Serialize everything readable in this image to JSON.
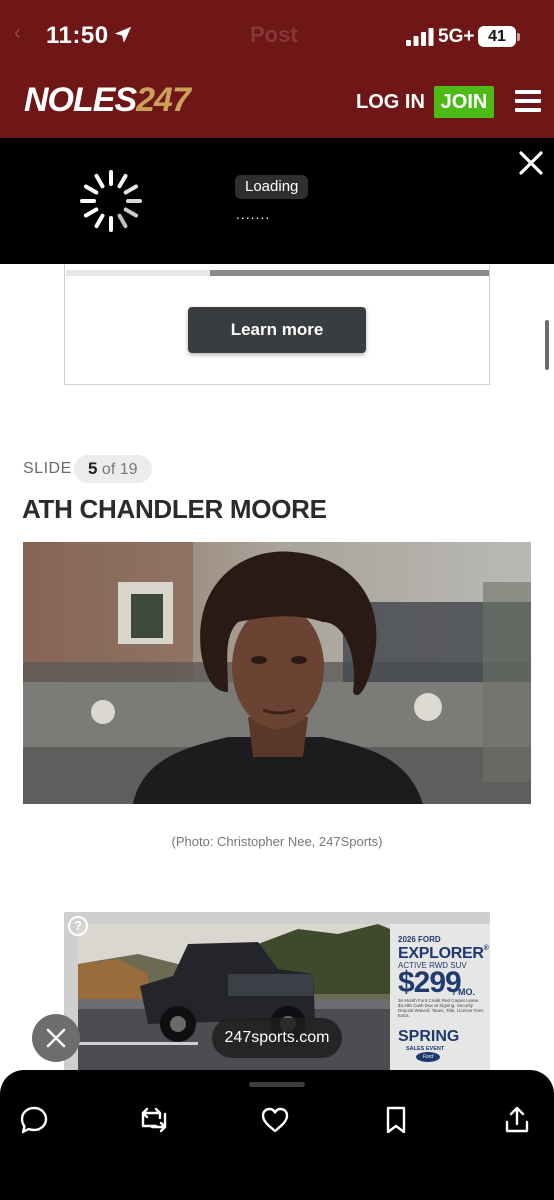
{
  "status_bar": {
    "time": "11:50",
    "network": "5G+",
    "battery": "41",
    "back_hint": "‹",
    "title_hint": "Post"
  },
  "site_header": {
    "logo_prefix": "NOLES",
    "logo_suffix": "247",
    "login_label": "LOG IN",
    "join_label": "JOIN",
    "colors": {
      "header_bg": "#6f1616",
      "join_bg": "#4cbb17",
      "logo_accent": "#c9a25a"
    }
  },
  "video_player": {
    "loading_label": "Loading",
    "loading_dots": ".......",
    "close_icon": "close-icon",
    "spinner_icon": "spinner-icon"
  },
  "ad_top": {
    "cta_label": "Learn more"
  },
  "slide": {
    "label": "SLIDE",
    "current": "5",
    "of_text": "of 19",
    "title": "ATH CHANDLER MOORE",
    "caption": "(Photo: Christopher Nee, 247Sports)"
  },
  "ad_bottom": {
    "info_glyph": "?",
    "brand_line": "2026 FORD",
    "model": "EXPLORER",
    "model_mark": "®",
    "trim": "ACTIVE RWD SUV",
    "price": "$299",
    "per_month": "/ MO.",
    "fine_print": "36 Month Ford Credit Red Carpet Lease. $4,495 Cash Due at Signing. Security Deposit Waived. Taxes, Title, License Fees Extra.",
    "event_title": "SPRING",
    "event_sub": "SALES EVENT",
    "ford_badge": "Ford",
    "site_label": "247sports.com",
    "dismiss_icon": "close-icon"
  },
  "toolbar": {
    "icons": [
      "reply-icon",
      "repost-icon",
      "like-icon",
      "bookmark-icon",
      "share-icon"
    ]
  }
}
